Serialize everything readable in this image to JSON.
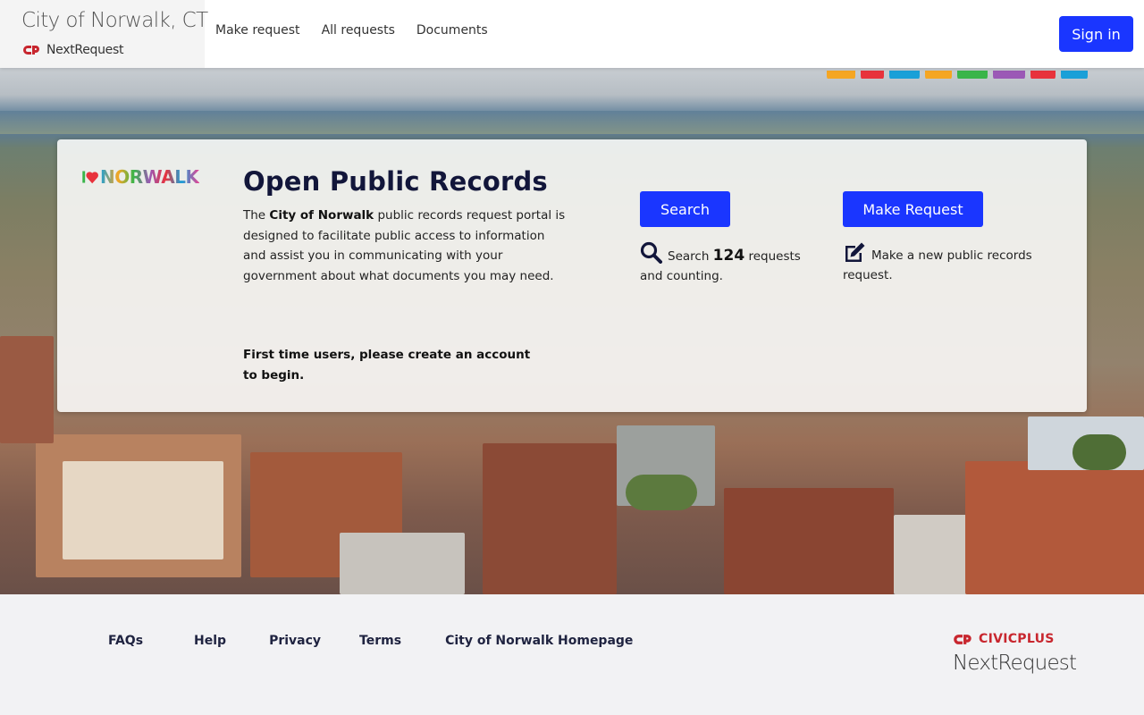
{
  "header": {
    "org_name": "City of Norwalk, CT",
    "product": "NextRequest",
    "nav": [
      "Make request",
      "All requests",
      "Documents"
    ],
    "signin_label": "Sign in"
  },
  "hero": {
    "title": "Open Public Records",
    "logo_text": "NORWALK",
    "intro_prefix": "The ",
    "intro_bold": "City of Norwalk",
    "intro_rest": " public records request portal is designed to facilitate public access to information and assist you in communicating with your government about what documents you may need.",
    "first_time": "First time users, please create an account to begin.",
    "search_button": "Search",
    "search_prefix": "Search ",
    "search_count": "124",
    "search_suffix": " requests and counting.",
    "make_button": "Make Request",
    "make_desc": "Make a new public records request."
  },
  "footer": {
    "links": [
      "FAQs",
      "Help",
      "Privacy",
      "Terms",
      "City of Norwalk Homepage"
    ],
    "brand": "CIVICPLUS",
    "brand_sub": "NextRequest"
  },
  "colors": {
    "primary": "#1a36ff",
    "brand_red": "#c8262e"
  },
  "icons": {
    "search": "search-icon",
    "make": "edit-icon",
    "logo": "civicplus-logo-icon"
  }
}
